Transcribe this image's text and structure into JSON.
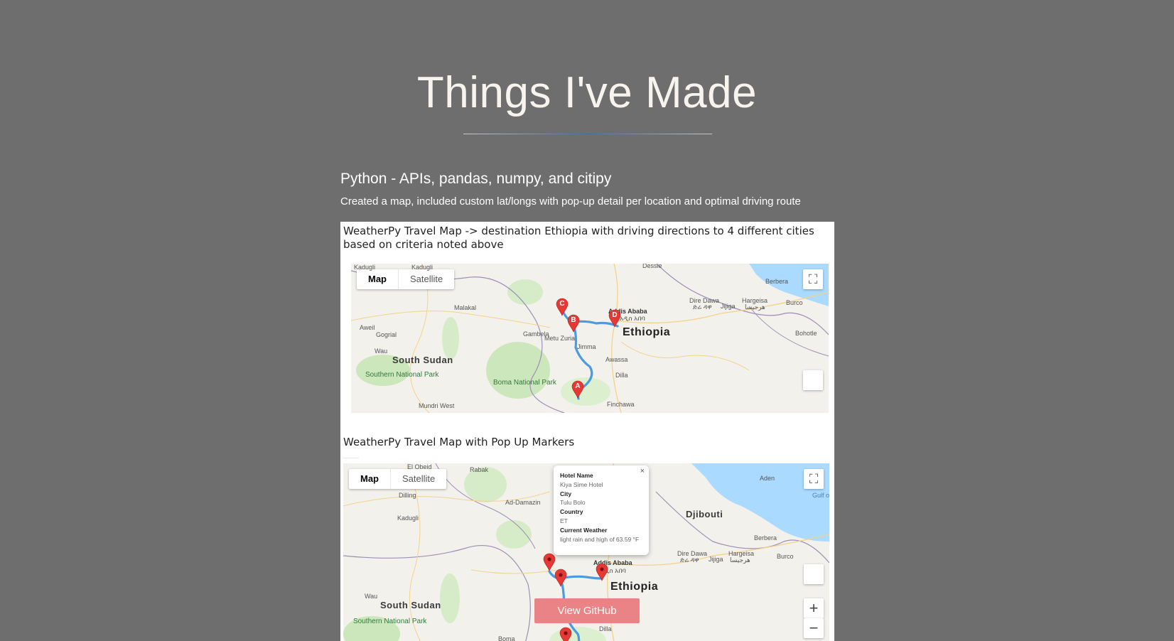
{
  "page": {
    "title": "Things I've Made"
  },
  "project": {
    "heading": "Python - APIs, pandas, numpy, and citipy",
    "description": "Created a map, included custom lat/longs with pop-up detail per location and optimal driving route",
    "github_label": "View GitHub",
    "caption_1": "WeatherPy Travel Map -> destination Ethiopia with driving directions to 4 different cities based on criteria noted above",
    "caption_2": "WeatherPy Travel Map with Pop Up Markers"
  },
  "map_controls": {
    "map_label": "Map",
    "satellite_label": "Satellite",
    "fullscreen_icon": "fullscreen-icon",
    "zoom_in": "+",
    "zoom_out": "−",
    "close": "×"
  },
  "map1": {
    "labels": {
      "ethiopia": "Ethiopia",
      "south_sudan": "South Sudan",
      "addis": "Addis Ababa",
      "addis_am": "አዲስ አበባ",
      "southern_park": "Southern National Park",
      "boma_park": "Boma National Park",
      "dire_dawa": "Dire Dawa",
      "dire_dawa_am": "ድሬ ዳዋ",
      "hargeisa": "Hargeisa",
      "hargeisa_so": "هرجيسا",
      "berbera": "Berbera",
      "burco": "Burco",
      "jijiga": "Jijiga",
      "bohotle": "Bohotle",
      "dessie": "Dessie",
      "malakal": "Malakal",
      "wau": "Wau",
      "gambela": "Gambela",
      "metu": "Metu Zuria",
      "jimma": "Jimma",
      "awassa": "Awassa",
      "dilla": "Dilla",
      "mundri": "Mundri West",
      "kadugli": "Kadugli",
      "aweil": "Aweil",
      "gogrial": "Gogrial",
      "kapoeta": "Finchawa"
    },
    "markers": [
      "A",
      "B",
      "C",
      "D"
    ]
  },
  "map2": {
    "labels": {
      "ethiopia": "Ethiopia",
      "south_sudan": "South Sudan",
      "djibouti": "Djibouti",
      "addis": "Addis Ababa",
      "addis_am": "አዲስ አበባ",
      "southern_park": "Southern National Park",
      "boma": "Boma",
      "dire_dawa": "Dire Dawa",
      "dire_dawa_am": "ድሬ ዳዋ",
      "hargeisa": "Hargeisa",
      "hargeisa_so": "هرجيسا",
      "berbera": "Berbera",
      "burco": "Burco",
      "jijiga": "Jijiga",
      "aden": "Aden",
      "rabak": "Rabak",
      "dilling": "Dilling",
      "kadugli": "Kadugli",
      "ad_damazin": "Ad-Damazin",
      "wau": "Wau",
      "el_obeid": "El Obeid",
      "dillo": "Dilla",
      "gulf": "Gulf o"
    },
    "popup": {
      "hotel_label": "Hotel Name",
      "hotel_value": "Kiya Sime Hotel",
      "city_label": "City",
      "city_value": "Tulu Bolo",
      "country_label": "Country",
      "country_value": "ET",
      "weather_label": "Current Weather",
      "weather_value": "light rain and high of 63.59 °F"
    }
  },
  "colors": {
    "background": "#6e6e6e",
    "github_button": "#ea8385",
    "route": "#4a9be3",
    "marker": "#e53935",
    "water": "#aadaff",
    "park": "#c8e6b4"
  }
}
